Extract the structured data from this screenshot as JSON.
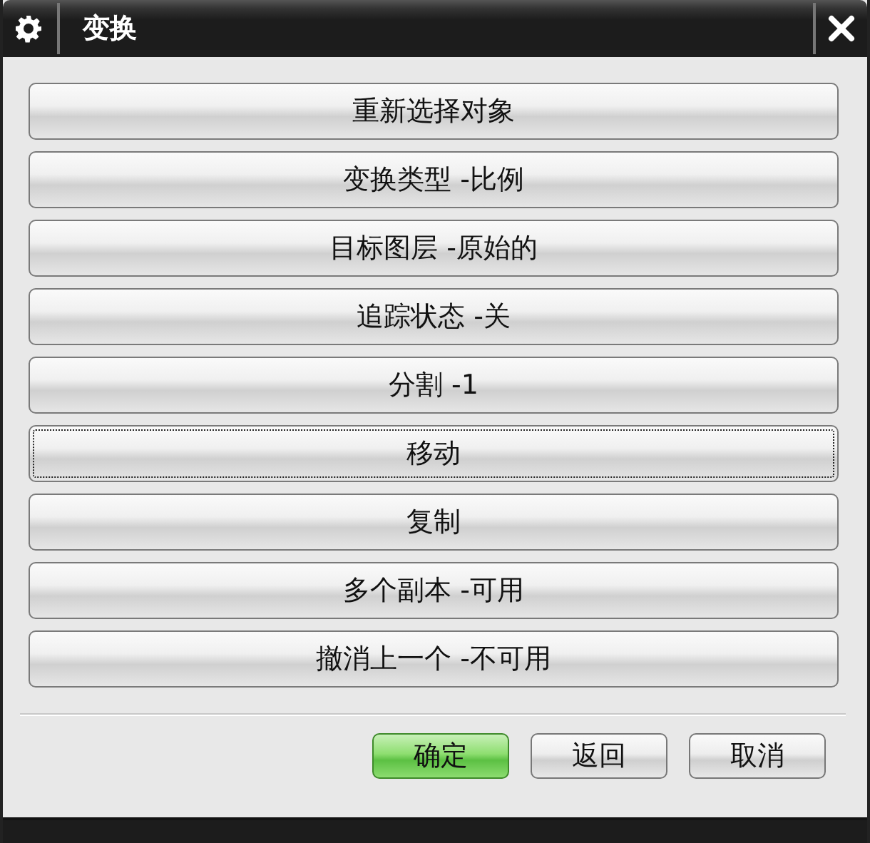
{
  "window": {
    "title": "变换"
  },
  "options": [
    {
      "label": "重新选择对象",
      "focused": false
    },
    {
      "label": "变换类型 -比例",
      "focused": false
    },
    {
      "label": "目标图层 -原始的",
      "focused": false
    },
    {
      "label": "追踪状态 -关",
      "focused": false
    },
    {
      "label": "分割 -1",
      "focused": false
    },
    {
      "label": "移动",
      "focused": true
    },
    {
      "label": "复制",
      "focused": false
    },
    {
      "label": "多个副本 -可用",
      "focused": false
    },
    {
      "label": "撤消上一个 -不可用",
      "focused": false
    }
  ],
  "buttons": [
    {
      "label": "确定",
      "default": true
    },
    {
      "label": "返回",
      "default": false
    },
    {
      "label": "取消",
      "default": false
    }
  ]
}
